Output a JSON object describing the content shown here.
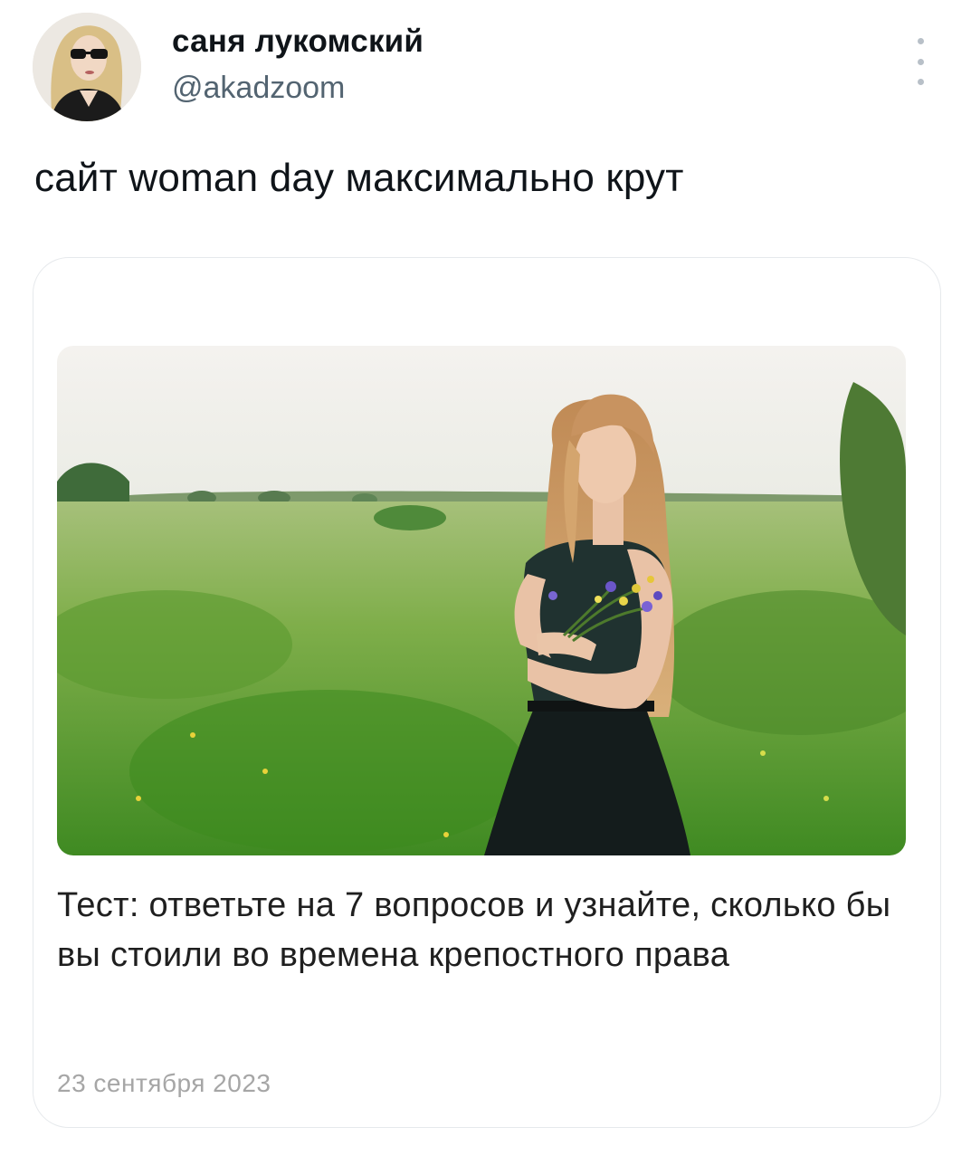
{
  "tweet": {
    "author_name": "саня лукомский",
    "author_handle": "@akadzoom",
    "text": "сайт woman day максимально крут",
    "more_icon": "more-vertical-icon"
  },
  "card": {
    "title": "Тест: ответьте на 7 вопросов и узнайте, сколько бы вы стоили во времена крепостного права",
    "date": "23 сентября 2023"
  },
  "colors": {
    "text_primary": "#0f1419",
    "text_secondary": "#536471",
    "card_border": "#e6e9ec",
    "date_gray": "#a6a6a6"
  }
}
